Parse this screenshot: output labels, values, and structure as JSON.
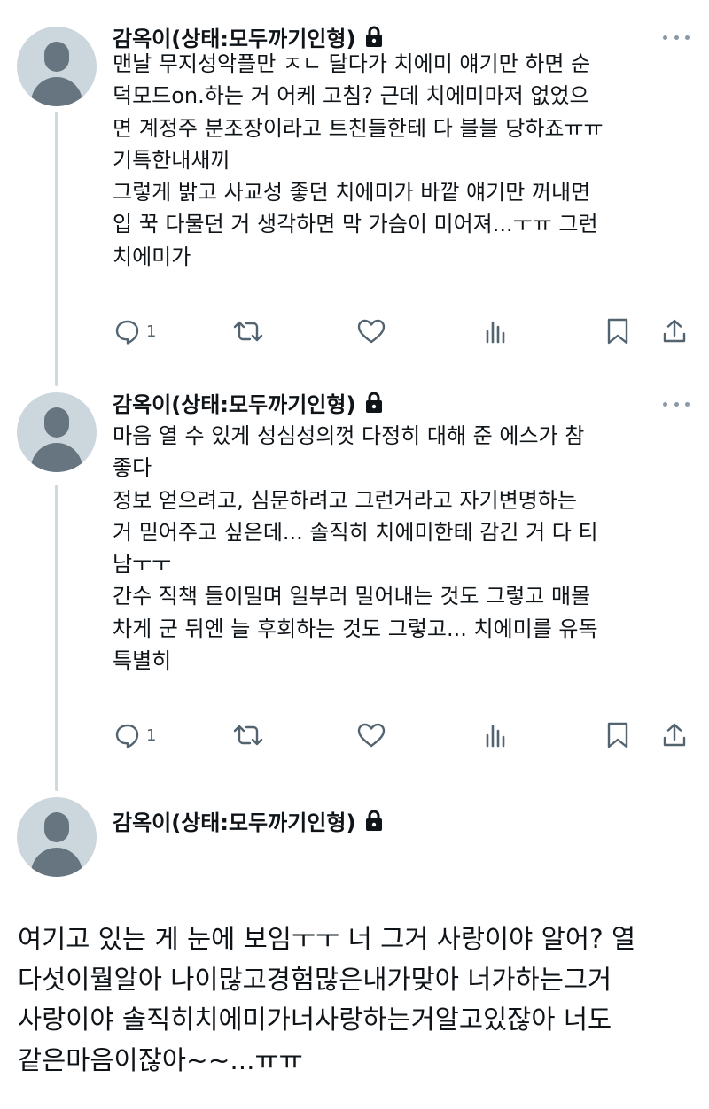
{
  "tweets": [
    {
      "display_name": "감옥이(상태:모두까기인형)",
      "paragraphs": [
        "맨날 무지성악플만 ㅈㄴ 달다가 치에미 얘기만 하면 순\n덕모드on.하는 거 어케 고침? 근데 치에미마저 없었으\n면 계정주 분조장이라고 트친들한테 다 블블 당하죠ㅠㅠ\n기특한내새끼",
        "그렇게 밝고 사교성 좋던 치에미가 바깥 얘기만 꺼내면\n입 꾹 다물던 거 생각하면 막 가슴이 미어져...ㅜㅠ 그런\n치에미가"
      ],
      "reply_count": "1"
    },
    {
      "display_name": "감옥이(상태:모두까기인형)",
      "paragraphs": [
        "마음 열 수 있게 성심성의껏 다정히 대해 준 에스가 참\n좋다",
        "정보 얻으려고, 심문하려고 그런거라고 자기변명하는\n거 믿어주고 싶은데... 솔직히 치에미한테 감긴 거 다 티\n남ㅜㅜ",
        "간수 직책 들이밀며 일부러 밀어내는 것도 그렇고 매몰\n차게 군 뒤엔 늘 후회하는 것도 그렇고... 치에미를 유독\n특별히"
      ],
      "reply_count": "1"
    },
    {
      "display_name": "감옥이(상태:모두까기인형)"
    }
  ],
  "reply_text": "여기고 있는 게 눈에 보임ㅜㅜ 너 그거 사랑이야 알어? 열\n다섯이뭘알아 나이많고경험많은내가맞아 너가하는그거\n사랑이야 솔직히치에미가너사랑하는거알고있잖아 너도\n같은마음이잖아~~...ㅠㅠ",
  "icons": {
    "reply": "reply-icon",
    "retweet": "retweet-icon",
    "like": "like-icon",
    "views": "views-icon",
    "bookmark": "bookmark-icon",
    "share": "share-icon",
    "lock": "lock-icon",
    "more": "more-icon"
  },
  "colors": {
    "text": "#0f1419",
    "secondary": "#536471",
    "thread_line": "#cfd9de",
    "avatar_bg": "#ccd6dd",
    "avatar_fg": "#66757f"
  }
}
